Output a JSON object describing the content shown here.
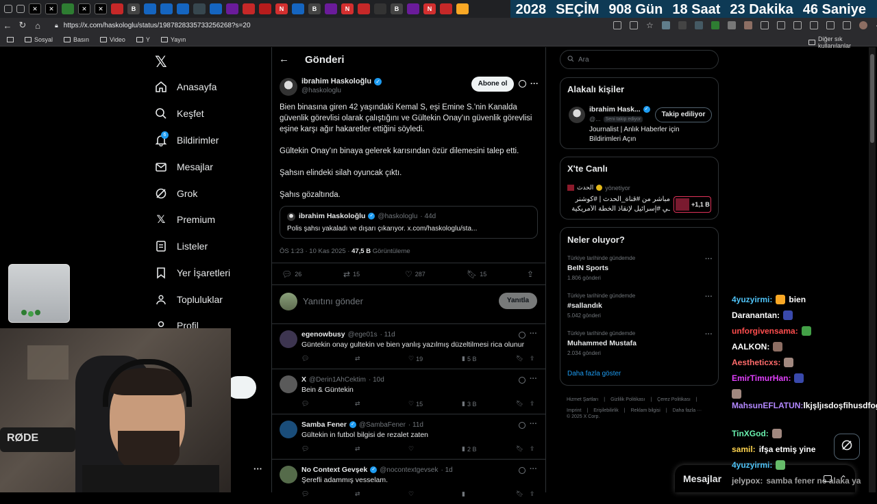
{
  "countdown": {
    "year": "2028",
    "label": "SEÇİM",
    "days": "908 Gün",
    "hours": "18 Saat",
    "minutes": "23 Dakika",
    "seconds": "46 Saniye"
  },
  "browser": {
    "url": "https://x.com/haskologlu/status/1987828335733256268?s=20",
    "bookmarks": [
      "Sosyal",
      "Basın",
      "Video",
      "Y",
      "Yayın"
    ],
    "other_bookmarks": "Diğer sık kullanılanlar",
    "colors": {
      "tab_bar": "#202124",
      "toolbar": "#2b2b2e",
      "countdown_bg": "#0e3a55"
    }
  },
  "nav": {
    "items": [
      {
        "label": "Anasayfa",
        "icon": "home-icon"
      },
      {
        "label": "Keşfet",
        "icon": "search-icon"
      },
      {
        "label": "Bildirimler",
        "icon": "bell-icon"
      },
      {
        "label": "Mesajlar",
        "icon": "mail-icon"
      },
      {
        "label": "Grok",
        "icon": "grok-icon"
      },
      {
        "label": "Premium",
        "icon": "x-logo-icon"
      },
      {
        "label": "Listeler",
        "icon": "list-icon"
      },
      {
        "label": "Yer İşaretleri",
        "icon": "bookmark-icon"
      },
      {
        "label": "Topluluklar",
        "icon": "people-icon"
      },
      {
        "label": "Profil",
        "icon": "person-icon"
      }
    ],
    "notification_badge": "6",
    "more": "···"
  },
  "post": {
    "header": "Gönderi",
    "author_name": "ibrahim Haskoloğlu",
    "author_handle": "@haskologlu",
    "subscribe_label": "Abone ol",
    "paragraphs": [
      "Bien binasına giren 42 yaşındaki Kemal S, eşi Emine S.'nin Kanalda güvenlik görevlisi olarak çalıştığını ve Gültekin Onay'ın güvenlik görevlisi eşine karşı ağır hakaretler ettiğini söyledi.",
      "Gültekin Onay'ın binaya gelerek karısından özür dilemesini talep etti.",
      "Şahsın elindeki silah oyuncak çıktı.",
      "Şahıs gözaltında."
    ],
    "quote": {
      "name": "ibrahim Haskoloğlu",
      "handle": "@haskologlu",
      "age": "· 44d",
      "text": "Polis şahsı yakaladı ve dışarı çıkarıyor. x.com/haskologlu/sta..."
    },
    "meta": {
      "time": "ÖS 1:23 · 10 Kas 2025 · ",
      "views": "47,5 B",
      "views_label": " Görüntüleme"
    },
    "stats": {
      "replies": "26",
      "reposts": "15",
      "likes": "287",
      "bookmarks": "15"
    },
    "reply_placeholder": "Yanıtını gönder",
    "reply_button": "Yanıtla"
  },
  "replies": [
    {
      "name": "egenowbusy",
      "handle": "@ege01s",
      "age": "· 11d",
      "verified": false,
      "text": "Güntekin onay gultekin ve bien yanlış yazılmış düzeltilmesi rica olunur",
      "replies": "",
      "reposts": "",
      "likes": "19",
      "views": "5 B"
    },
    {
      "name": "X",
      "handle": "@Derin1AhCektim",
      "age": "· 10d",
      "verified": false,
      "text": "Bein & Güntekin",
      "replies": "",
      "reposts": "",
      "likes": "15",
      "views": "3 B"
    },
    {
      "name": "Samba Fener",
      "handle": "@SambaFener",
      "age": "· 11d",
      "verified": true,
      "text": "Gültekin in futbol bilgisi de rezalet zaten",
      "replies": "",
      "reposts": "",
      "likes": "",
      "views": "2 B"
    },
    {
      "name": "No Context Gevşek",
      "handle": "@nocontextgevsek",
      "age": "· 1d",
      "verified": true,
      "text": "Şerefli adammış vesselam.",
      "replies": "",
      "reposts": "",
      "likes": "",
      "views": ""
    }
  ],
  "search": {
    "placeholder": "Ara"
  },
  "related": {
    "title": "Alakalı kişiler",
    "name": "ibrahim Hask...",
    "handle": "@...",
    "follows_you": "Seni takip ediyor",
    "follow_button": "Takip ediliyor",
    "bio": "Journalist | Anlık Haberler için Bildirimleri Açın"
  },
  "live": {
    "title": "X'te Canlı",
    "host": "الحدث",
    "host_role": "yönetiyor",
    "line1": "مباشر من #قناة_الحدث | #كوشنر",
    "line2": "ـي #إسرائيل لإنقاذ الخطة الأمريكية",
    "viewers": "+1,1 B"
  },
  "trends": {
    "title": "Neler oluyor?",
    "items": [
      {
        "context": "Türkiye tarihinde gündemde",
        "name": "BeIN Sports",
        "count": "1.806 gönderi"
      },
      {
        "context": "Türkiye tarihinde gündemde",
        "name": "#sallandık",
        "count": "5.042 gönderi"
      },
      {
        "context": "Türkiye tarihinde gündemde",
        "name": "Muhammed Mustafa",
        "count": "2.034 gönderi"
      }
    ],
    "more": "Daha fazla göster"
  },
  "footer": {
    "links": [
      "Hizmet Şartları",
      "|",
      "Gizlilik Politikası",
      "|",
      "Çerez Politikası",
      "|",
      "Imprint",
      "|",
      "Erişilebilirlik",
      "|",
      "Reklam bilgisi",
      "|",
      "Daha fazla ···"
    ],
    "copyright": "© 2025 X Corp."
  },
  "messages_label": "Mesajlar",
  "chat": [
    {
      "user": "4yuzyirmi:",
      "text": "bien",
      "color": "#4fc3f7"
    },
    {
      "user": "Daranantan:",
      "text": "",
      "color": "#ffffff"
    },
    {
      "user": "unforgivensama:",
      "text": "",
      "color": "#ff4d4d"
    },
    {
      "user": "AALKON:",
      "text": "",
      "color": "#ffffff"
    },
    {
      "user": "Aestheticxs:",
      "text": "",
      "color": "#ff6b6b"
    },
    {
      "user": "EmirTimurHan:",
      "text": "",
      "color": "#e040fb"
    },
    {
      "user": "MahsunEFLATUN:",
      "text": "lkjşljısdoşfihusdfogsdf",
      "color": "#b388ff"
    },
    {
      "user": "TinXGod:",
      "text": "",
      "color": "#69f0ae"
    },
    {
      "user": "samil:",
      "text": "ifşa etmiş yine",
      "color": "#ffd54f"
    },
    {
      "user": "4yuzyirmi:",
      "text": "",
      "color": "#4fc3f7"
    },
    {
      "user": "jelypox:",
      "text": "samba fener ne alaka ya",
      "color": "#aaaaaa"
    }
  ]
}
